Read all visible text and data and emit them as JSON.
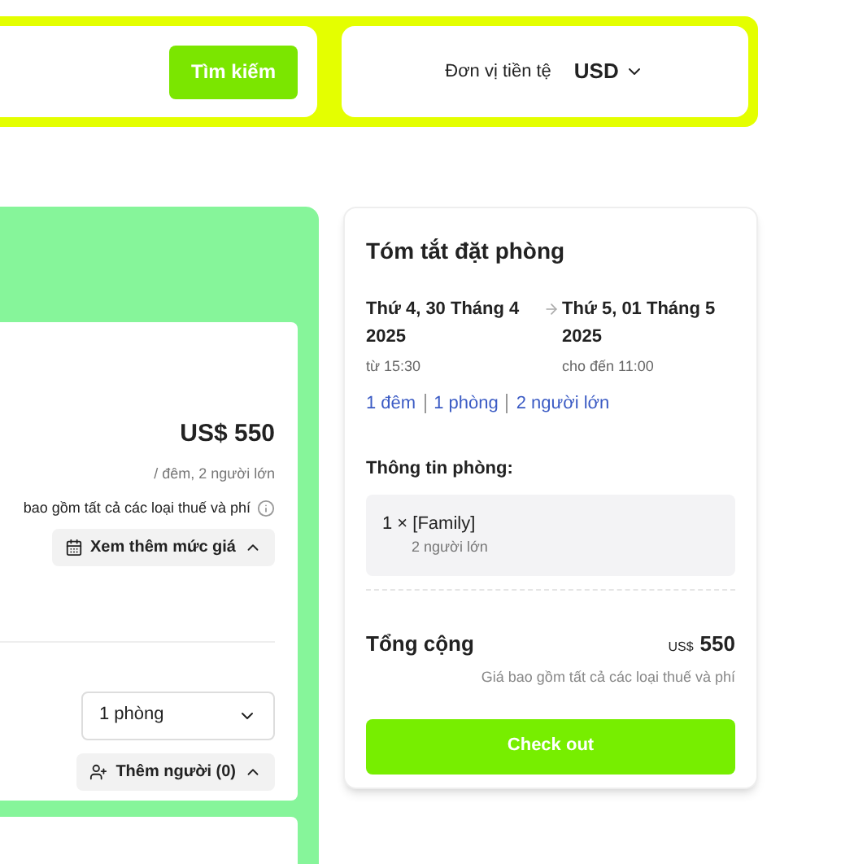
{
  "search": {
    "button": "Tìm kiếm"
  },
  "currency": {
    "label": "Đơn vị tiền tệ",
    "value": "USD"
  },
  "rate": {
    "price": "US$ 550",
    "per": "/ đêm, 2 người lớn",
    "tax_note": "bao gồm tất cả các loại thuế và phí",
    "more_rates": "Xem thêm mức giá",
    "rooms": "1 phòng",
    "add_guests": "Thêm người (0)"
  },
  "summary": {
    "title": "Tóm tắt đặt phòng",
    "checkin": {
      "date": "Thứ 4, 30 Tháng 4 2025",
      "time": "từ 15:30"
    },
    "checkout": {
      "date": "Thứ 5, 01 Tháng 5 2025",
      "time": "cho đến 11:00"
    },
    "stay": [
      "1 đêm",
      "1 phòng",
      "2 người lớn"
    ],
    "room_info_label": "Thông tin phòng:",
    "room": {
      "name": "1 × [Family]",
      "guests": "2 người lớn"
    },
    "total_label": "Tổng cộng",
    "total_currency": "US$",
    "total_amount": "550",
    "total_note": "Giá bao gồm tất cả các loại thuế và phí",
    "checkout_button": "Check out"
  }
}
